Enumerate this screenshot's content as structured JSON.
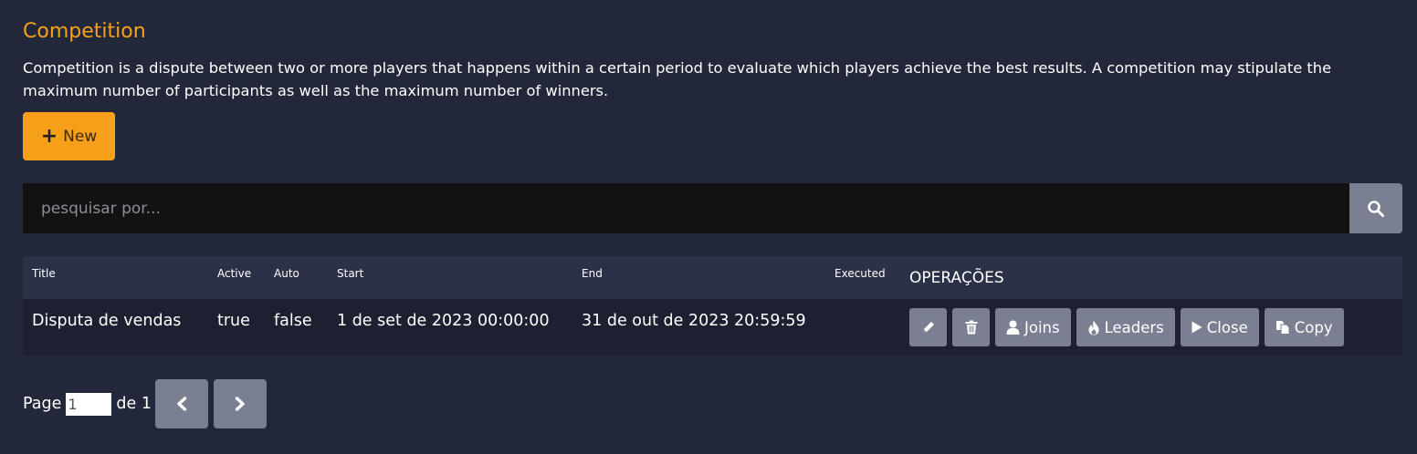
{
  "page": {
    "title": "Competition",
    "description": "Competition is a dispute between two or more players that happens within a certain period to evaluate which players achieve the best results. A competition may stipulate the maximum number of participants as well as the maximum number of winners.",
    "new_button": {
      "label": "New",
      "icon": "plus-icon"
    }
  },
  "search": {
    "placeholder": "pesquisar por...",
    "value": "",
    "button_icon": "search-icon"
  },
  "table": {
    "columns": [
      "Title",
      "Active",
      "Auto",
      "Start",
      "End",
      "Executed",
      "OPERAÇÕES"
    ],
    "rows": [
      {
        "title": "Disputa de vendas",
        "active": "true",
        "auto": "false",
        "start": "1 de set de 2023 00:00:00",
        "end": "31 de out de 2023 20:59:59",
        "executed": "",
        "operations": {
          "edit_icon": "pencil-icon",
          "delete_icon": "trash-icon",
          "joins": "Joins",
          "leaders": "Leaders",
          "close": "Close",
          "copy": "Copy"
        }
      }
    ]
  },
  "pagination": {
    "page_label": "Page",
    "current_page": "1",
    "of_label": "de 1",
    "prev_icon": "chevron-left-icon",
    "next_icon": "chevron-right-icon"
  },
  "colors": {
    "background": "#22283a",
    "accent": "#f6a01a",
    "button": "#7a7f92",
    "header_row": "#2b3147",
    "body_row": "#1c2030"
  }
}
